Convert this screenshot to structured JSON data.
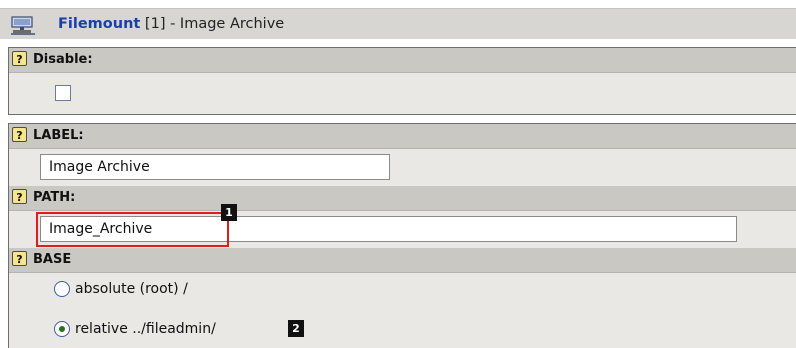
{
  "header": {
    "title": "Filemount",
    "record_suffix": " [1] - Image Archive",
    "icon": "filemount-icon"
  },
  "fields": {
    "disable": {
      "label": "Disable:",
      "checked": false
    },
    "label": {
      "label": "LABEL:",
      "value": "Image Archive"
    },
    "path": {
      "label": "PATH:",
      "value": "Image_Archive"
    },
    "base": {
      "label": "BASE",
      "options": [
        {
          "label": "absolute (root) /",
          "selected": false
        },
        {
          "label": "relative ../fileadmin/",
          "selected": true
        }
      ]
    }
  },
  "markers": {
    "path_marker": "1",
    "base_marker": "2"
  },
  "help_icon_glyph": "?",
  "colors": {
    "highlight": "#e21b1b",
    "header_title": "#1a3fa8"
  }
}
